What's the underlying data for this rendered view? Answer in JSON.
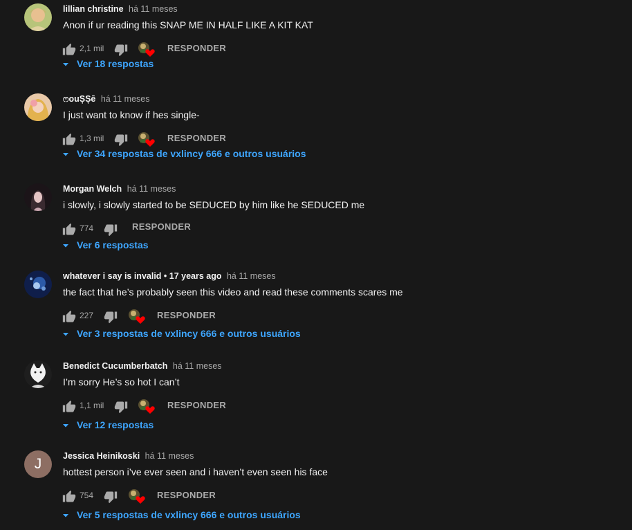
{
  "colors": {
    "background": "#181818",
    "text": "#f1f1f1",
    "secondary_text": "#aaaaaa",
    "link": "#3ea6ff",
    "heart": "#ff0000"
  },
  "reply_label": "RESPONDER",
  "comments": [
    {
      "author": "lillian christine",
      "time": "há 11 meses",
      "text": "Anon if ur reading this SNAP ME IN HALF LIKE A KIT KAT",
      "likes": "2,1 mil",
      "hearted": true,
      "replies": "Ver 18 respostas"
    },
    {
      "author": "ෆouȘȘē",
      "time": "há 11 meses",
      "text": "I just want to know if hes single-",
      "likes": "1,3 mil",
      "hearted": true,
      "replies": "Ver 34 respostas de vxlincy 666 e outros usuários"
    },
    {
      "author": "Morgan Welch",
      "time": "há 11 meses",
      "text": "i slowly, i slowly started to be SEDUCED by him like he SEDUCED me",
      "likes": "774",
      "hearted": false,
      "replies": "Ver 6 respostas"
    },
    {
      "author": "whatever i say is invalid • 17 years ago",
      "time": "há 11 meses",
      "text": "the fact that he’s probably seen this video and read these comments scares me",
      "likes": "227",
      "hearted": true,
      "replies": "Ver 3 respostas de vxlincy 666 e outros usuários"
    },
    {
      "author": "Benedict Cucumberbatch",
      "time": "há 11 meses",
      "text": "I’m sorry He’s so hot I can’t",
      "likes": "1,1 mil",
      "hearted": true,
      "replies": "Ver 12 respostas"
    },
    {
      "author": "Jessica Heinikoski",
      "time": "há 11 meses",
      "avatar_letter": "J",
      "text": "hottest person i’ve ever seen and i haven’t even seen his face",
      "likes": "754",
      "hearted": true,
      "replies": "Ver 5 respostas de vxlincy 666 e outros usuários"
    }
  ]
}
